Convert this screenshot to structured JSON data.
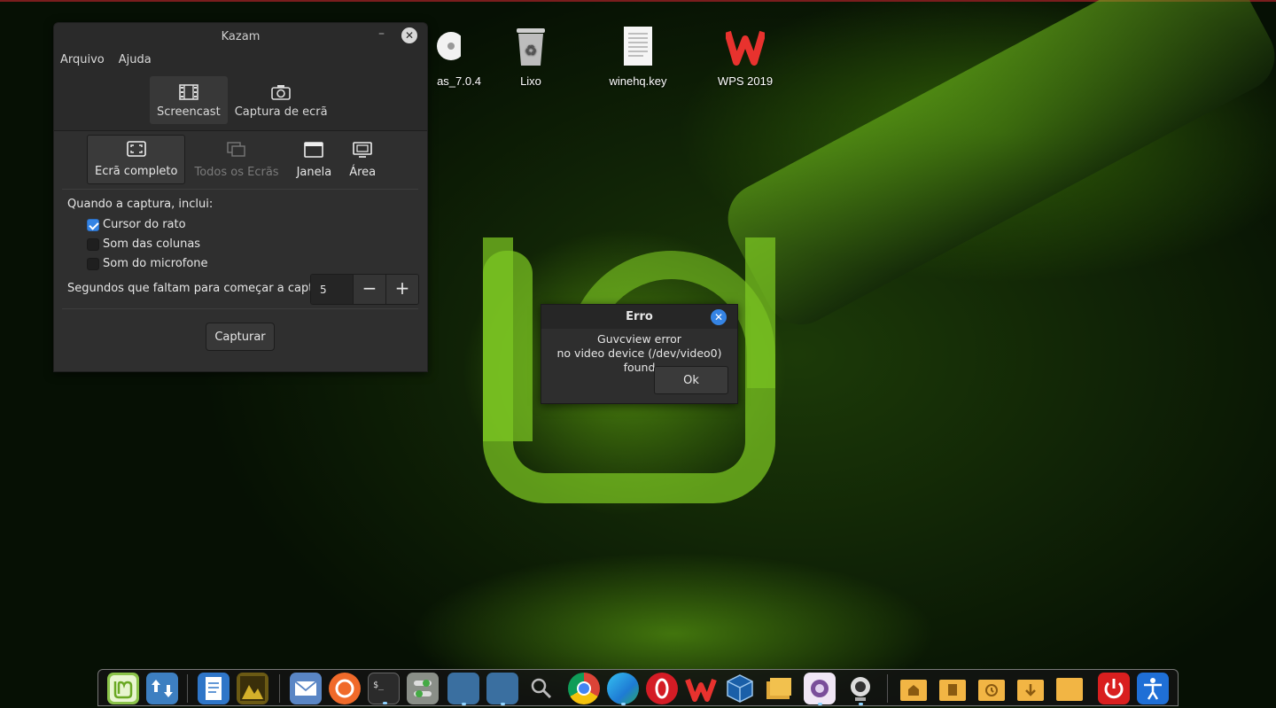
{
  "desktop": {
    "icons": [
      {
        "label": "as_7.0.4",
        "icon": "disc-icon"
      },
      {
        "label": "Lixo",
        "icon": "trash-icon"
      },
      {
        "label": "winehq.key",
        "icon": "document-icon"
      },
      {
        "label": "WPS 2019",
        "icon": "wps-logo-icon"
      }
    ]
  },
  "kazam": {
    "title": "Kazam",
    "menu": [
      "Arquivo",
      "Ajuda"
    ],
    "tabs": [
      {
        "label": "Screencast",
        "icon": "film-icon",
        "active": true
      },
      {
        "label": "Captura de ecrã",
        "icon": "camera-icon",
        "active": false
      }
    ],
    "modes": [
      {
        "label": "Ecrã completo",
        "icon": "fullscreen-icon",
        "state": "active"
      },
      {
        "label": "Todos os Ecrãs",
        "icon": "monitors-icon",
        "state": "disabled"
      },
      {
        "label": "Janela",
        "icon": "window-icon",
        "state": "normal"
      },
      {
        "label": "Área",
        "icon": "area-icon",
        "state": "normal"
      }
    ],
    "include_label": "Quando a captura, inclui:",
    "checks": [
      {
        "label": "Cursor do rato",
        "checked": true
      },
      {
        "label": "Som das colunas",
        "checked": false
      },
      {
        "label": "Som do microfone",
        "checked": false
      }
    ],
    "countdown_label": "Segundos que faltam para começar a captura",
    "countdown_value": "5",
    "minus": "−",
    "plus": "+",
    "capture_button": "Capturar"
  },
  "error_dialog": {
    "title": "Erro",
    "line1": "Guvcview error",
    "line2": "no video device (/dev/video0) found",
    "ok": "Ok"
  },
  "dock": {
    "items": [
      "mint-menu-icon",
      "update-manager-icon",
      "text-editor-icon",
      "image-viewer-icon",
      "mail-icon",
      "firefox-icon",
      "terminal-icon",
      "settings-icon",
      "workspace-1-icon",
      "workspace-2-icon",
      "search-icon",
      "chrome-icon",
      "edge-icon",
      "opera-icon",
      "wps-icon",
      "virtualbox-icon",
      "files-icon",
      "screenshot-icon",
      "webcam-icon",
      "home-folder-icon",
      "documents-folder-icon",
      "recent-folder-icon",
      "downloads-folder-icon",
      "folder-icon",
      "power-icon",
      "accessibility-icon"
    ]
  },
  "colors": {
    "accent": "#3584e4",
    "window_bg": "#2f2f2f",
    "wallpaper_green": "#7dc823"
  }
}
